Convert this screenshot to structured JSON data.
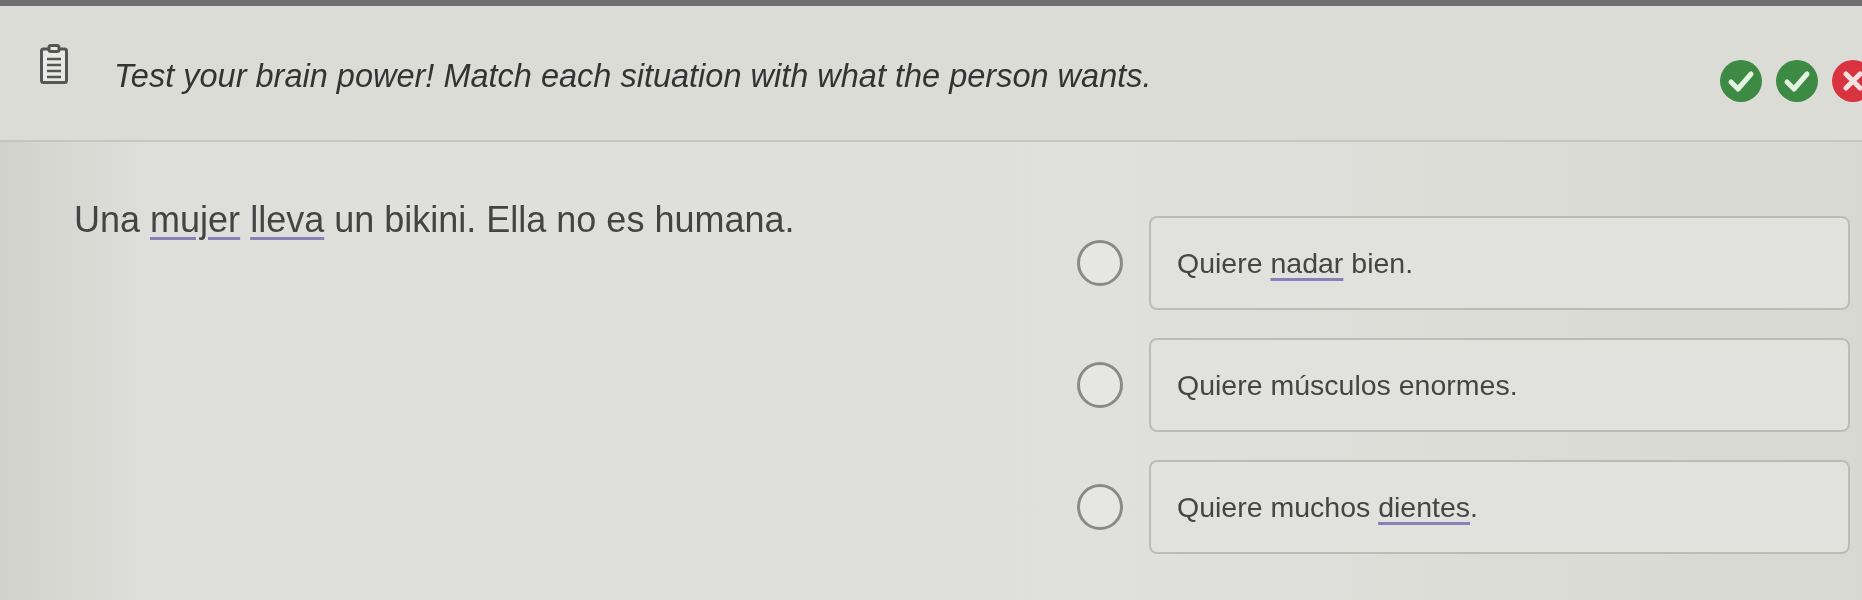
{
  "header": {
    "title": "Test your brain power! Match each situation with what the person wants.",
    "progress": [
      {
        "kind": "correct"
      },
      {
        "kind": "correct"
      },
      {
        "kind": "incorrect"
      }
    ]
  },
  "question": {
    "segments": [
      {
        "kind": "plain",
        "text": "Una "
      },
      {
        "kind": "vocab",
        "text": "mujer"
      },
      {
        "kind": "vocab",
        "text": "lleva"
      },
      {
        "kind": "plain",
        "text": " un bikini. Ella no es humana."
      }
    ]
  },
  "options": [
    {
      "selected": false,
      "segments": [
        {
          "kind": "plain",
          "text": "Quiere "
        },
        {
          "kind": "vocab",
          "text": "nadar"
        },
        {
          "kind": "plain",
          "text": " bien."
        }
      ]
    },
    {
      "selected": false,
      "segments": [
        {
          "kind": "plain",
          "text": "Quiere músculos enormes."
        }
      ]
    },
    {
      "selected": false,
      "segments": [
        {
          "kind": "plain",
          "text": "Quiere muchos "
        },
        {
          "kind": "vocab",
          "text": "dientes"
        },
        {
          "kind": "plain",
          "text": "."
        }
      ]
    }
  ]
}
